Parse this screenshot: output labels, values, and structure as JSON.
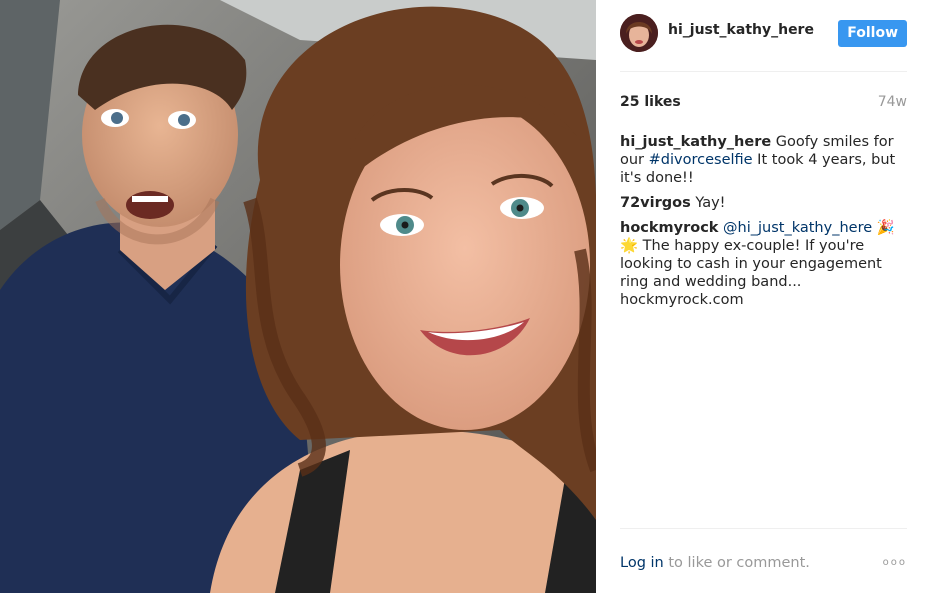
{
  "post": {
    "username": "hi_just_kathy_here",
    "follow_label": "Follow",
    "likes": "25 likes",
    "age": "74w"
  },
  "comments": [
    {
      "user": "hi_just_kathy_here",
      "text_before": " Goofy smiles for our ",
      "link": "#divorceselfie",
      "text_after": " It took 4 years, but it's done!!"
    },
    {
      "user": "72virgos",
      "text": " Yay!"
    },
    {
      "user": "hockmyrock",
      "mention": "@hi_just_kathy_here",
      "emoji": " 🎉🌟",
      "text": " The happy ex-couple! If you're looking to cash in your engagement ring and wedding band... hockmyrock.com"
    }
  ],
  "footer": {
    "login_link": "Log in",
    "login_text": " to like or comment.",
    "more_icon": "ooo"
  },
  "colors": {
    "follow_button": "#3897f0",
    "link": "#003569",
    "muted": "#999999"
  },
  "icons": {
    "more": "more-options-icon",
    "avatar": "user-avatar"
  }
}
